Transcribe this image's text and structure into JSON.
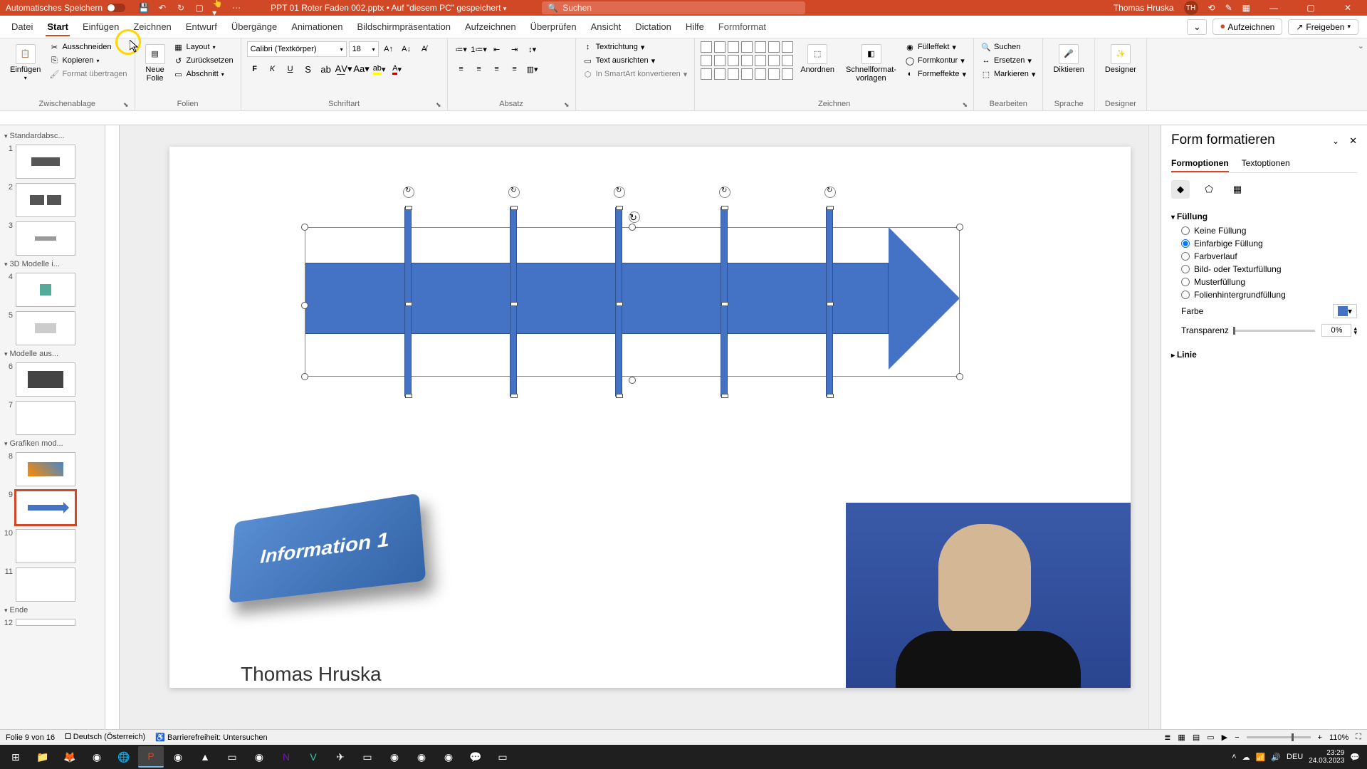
{
  "titlebar": {
    "autosave_label": "Automatisches Speichern",
    "filename": "PPT 01 Roter Faden 002.pptx • Auf \"diesem PC\" gespeichert",
    "search_placeholder": "Suchen",
    "username": "Thomas Hruska",
    "initials": "TH"
  },
  "tabs": {
    "list": [
      "Datei",
      "Start",
      "Einfügen",
      "Zeichnen",
      "Entwurf",
      "Übergänge",
      "Animationen",
      "Bildschirmpräsentation",
      "Aufzeichnen",
      "Überprüfen",
      "Ansicht",
      "Dictation",
      "Hilfe"
    ],
    "active": "Start",
    "context": "Formformat",
    "record": "Aufzeichnen",
    "share": "Freigeben"
  },
  "ribbon": {
    "clipboard": {
      "paste": "Einfügen",
      "cut": "Ausschneiden",
      "copy": "Kopieren",
      "painter": "Format übertragen",
      "label": "Zwischenablage"
    },
    "slides": {
      "new": "Neue\nFolie",
      "layout": "Layout",
      "reset": "Zurücksetzen",
      "section": "Abschnitt",
      "label": "Folien"
    },
    "font": {
      "name": "Calibri (Textkörper)",
      "size": "18",
      "label": "Schriftart"
    },
    "para": {
      "textdir": "Textrichtung",
      "align": "Text ausrichten",
      "smartart": "In SmartArt konvertieren",
      "label": "Absatz"
    },
    "drawing": {
      "arrange": "Anordnen",
      "quick": "Schnellformat-\nvorlagen",
      "filleff": "Fülleffekt",
      "contour": "Formkontur",
      "effects": "Formeffekte",
      "label": "Zeichnen"
    },
    "editing": {
      "find": "Suchen",
      "replace": "Ersetzen",
      "select": "Markieren",
      "label": "Bearbeiten"
    },
    "voice": {
      "dictate": "Diktieren",
      "label": "Sprache"
    },
    "designer": {
      "btn": "Designer",
      "label": "Designer"
    }
  },
  "thumbs": {
    "sec1": "Standardabsc...",
    "sec2": "3D Modelle i...",
    "sec3": "Modelle aus...",
    "sec4": "Grafiken mod...",
    "sec5": "Ende"
  },
  "slide": {
    "block_text": "Information 1",
    "presenter": "Thomas Hruska"
  },
  "sidepanel": {
    "title": "Form formatieren",
    "tab_shape": "Formoptionen",
    "tab_text": "Textoptionen",
    "fill_hdr": "Füllung",
    "fill_none": "Keine Füllung",
    "fill_solid": "Einfarbige Füllung",
    "fill_grad": "Farbverlauf",
    "fill_pic": "Bild- oder Texturfüllung",
    "fill_pattern": "Musterfüllung",
    "fill_bg": "Folienhintergrundfüllung",
    "color_lbl": "Farbe",
    "transp_lbl": "Transparenz",
    "transp_val": "0%",
    "line_hdr": "Linie"
  },
  "status": {
    "slide": "Folie 9 von 16",
    "lang": "Deutsch (Österreich)",
    "access": "Barrierefreiheit: Untersuchen",
    "zoom": "110%"
  },
  "tray": {
    "kbd": "DEU",
    "time": "23:29",
    "date": "24.03.2023"
  }
}
